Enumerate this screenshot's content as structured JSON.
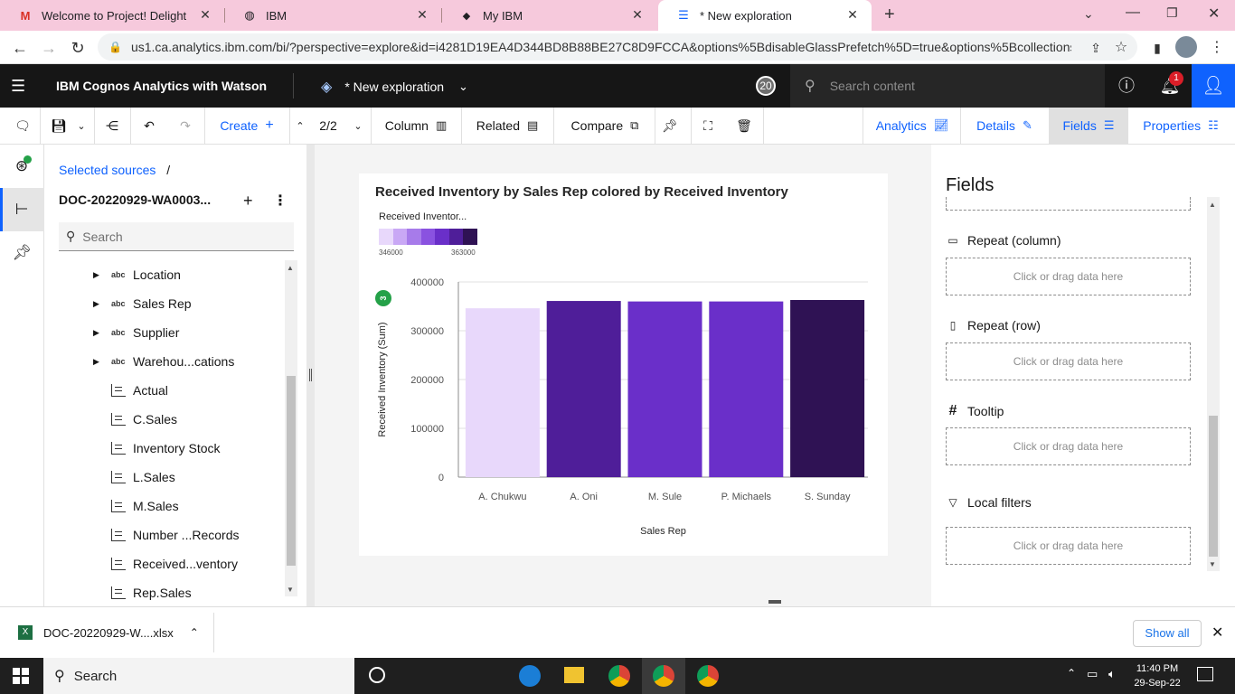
{
  "browser": {
    "tabs": [
      {
        "label": "Welcome to Project! Delighted to",
        "icon": "gmail-icon"
      },
      {
        "label": "IBM",
        "icon": "globe-icon"
      },
      {
        "label": "My IBM",
        "icon": "ibm-icon"
      },
      {
        "label": "* New exploration",
        "icon": "exploration-icon"
      }
    ],
    "url": "us1.ca.analytics.ibm.com/bi/?perspective=explore&id=i4281D19EA4D344BD8B88BE27C8D9FCCA&options%5BdisableGlassPrefetch%5D=true&options%5Bcollections%..."
  },
  "header": {
    "brand": "IBM Cognos Analytics with Watson",
    "exploration_title": "* New exploration",
    "badge_count": "20",
    "search_placeholder": "Search content",
    "notification_count": "1"
  },
  "toolbar": {
    "create": "Create",
    "page": "2/2",
    "column": "Column",
    "related": "Related",
    "compare": "Compare",
    "analytics": "Analytics",
    "details": "Details",
    "fields": "Fields",
    "properties": "Properties"
  },
  "sources": {
    "breadcrumb": "Selected sources",
    "breadcrumb_sep": "/",
    "name": "DOC-20220929-WA0003...",
    "search_placeholder": "Search",
    "items": [
      {
        "label": "Location",
        "type": "abc"
      },
      {
        "label": "Sales Rep",
        "type": "abc"
      },
      {
        "label": "Supplier",
        "type": "abc"
      },
      {
        "label": "Warehou...cations",
        "type": "abc"
      },
      {
        "label": "Actual",
        "type": "measure"
      },
      {
        "label": "C.Sales",
        "type": "measure"
      },
      {
        "label": "Inventory Stock",
        "type": "measure"
      },
      {
        "label": "L.Sales",
        "type": "measure"
      },
      {
        "label": "M.Sales",
        "type": "measure"
      },
      {
        "label": "Number ...Records",
        "type": "measure"
      },
      {
        "label": "Received...ventory",
        "type": "measure"
      },
      {
        "label": "Rep.Sales",
        "type": "measure"
      }
    ]
  },
  "chart_data": {
    "type": "bar",
    "title": "Received Inventory by Sales Rep colored by Received Inventory",
    "xlabel": "Sales Rep",
    "ylabel": "Received Inventory (Sum)",
    "legend_title": "Received Inventor...",
    "legend_min": "346000",
    "legend_max": "363000",
    "legend_colors": [
      "#e8d8fb",
      "#c9a8f5",
      "#a77bea",
      "#8a52e0",
      "#6a2fc9",
      "#4f1e99",
      "#2f1254"
    ],
    "categories": [
      "A. Chukwu",
      "A. Oni",
      "M. Sule",
      "P. Michaels",
      "S. Sunday"
    ],
    "values": [
      346000,
      361000,
      360000,
      360000,
      363000
    ],
    "bar_colors": [
      "#e8d8fb",
      "#4f1e99",
      "#6a2fc9",
      "#6a2fc9",
      "#2f1254"
    ],
    "yticks": [
      "400000",
      "300000",
      "200000",
      "100000",
      "0"
    ],
    "ylim": [
      0,
      400000
    ],
    "marker": "3"
  },
  "fields_panel": {
    "title": "Fields",
    "slots": [
      {
        "label": "Repeat (column)",
        "placeholder": "Click or drag data here",
        "icon": "repeat-column-icon"
      },
      {
        "label": "Repeat (row)",
        "placeholder": "Click or drag data here",
        "icon": "repeat-row-icon"
      },
      {
        "label": "Tooltip",
        "placeholder": "Click or drag data here",
        "icon": "hash-icon"
      },
      {
        "label": "Local filters",
        "placeholder": "Click or drag data here",
        "icon": "filter-icon"
      }
    ]
  },
  "downloads": {
    "file": "DOC-20220929-W....xlsx",
    "show_all": "Show all"
  },
  "taskbar": {
    "search": "Search",
    "time": "11:40 PM",
    "date": "29-Sep-22"
  }
}
